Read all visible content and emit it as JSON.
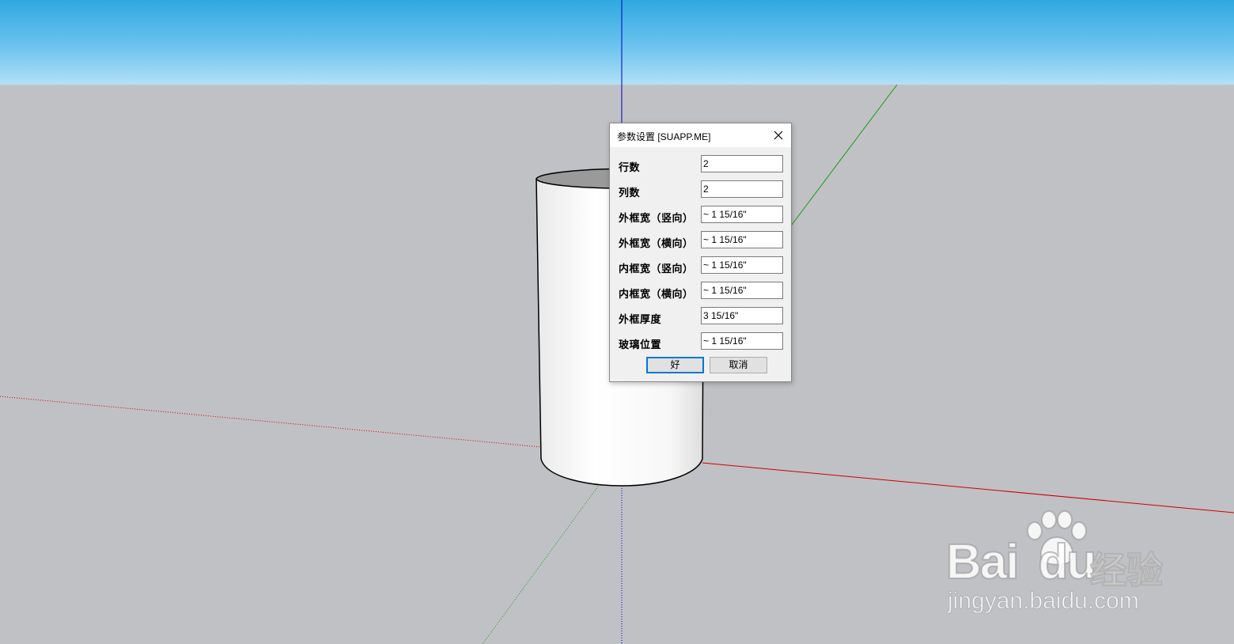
{
  "dialog": {
    "title": "参数设置 [SUAPP.ME]",
    "fields": [
      {
        "label": "行数",
        "value": "2"
      },
      {
        "label": "列数",
        "value": "2"
      },
      {
        "label": "外框宽（竖向）",
        "value": "~ 1 15/16\""
      },
      {
        "label": "外框宽（横向）",
        "value": "~ 1 15/16\""
      },
      {
        "label": "内框宽（竖向）",
        "value": "~ 1 15/16\""
      },
      {
        "label": "内框宽（横向）",
        "value": "~ 1 15/16\""
      },
      {
        "label": "外框厚度",
        "value": "3 15/16\""
      },
      {
        "label": "玻璃位置",
        "value": "~ 1 15/16\""
      }
    ],
    "ok_label": "好",
    "cancel_label": "取消"
  },
  "watermark": {
    "brand": "Bai",
    "brand2": "du",
    "cn": "经验",
    "url": "jingyan.baidu.com"
  },
  "colors": {
    "sky_top": "#2fa8e0",
    "ground": "#c0c1c5",
    "axis_red": "#cc0000",
    "axis_green": "#1a9a1a",
    "axis_blue": "#0000cc",
    "focus_accent": "#0078d7"
  },
  "icons": {
    "close": "close-icon",
    "watermark_logo": "baidu-paw-icon"
  }
}
